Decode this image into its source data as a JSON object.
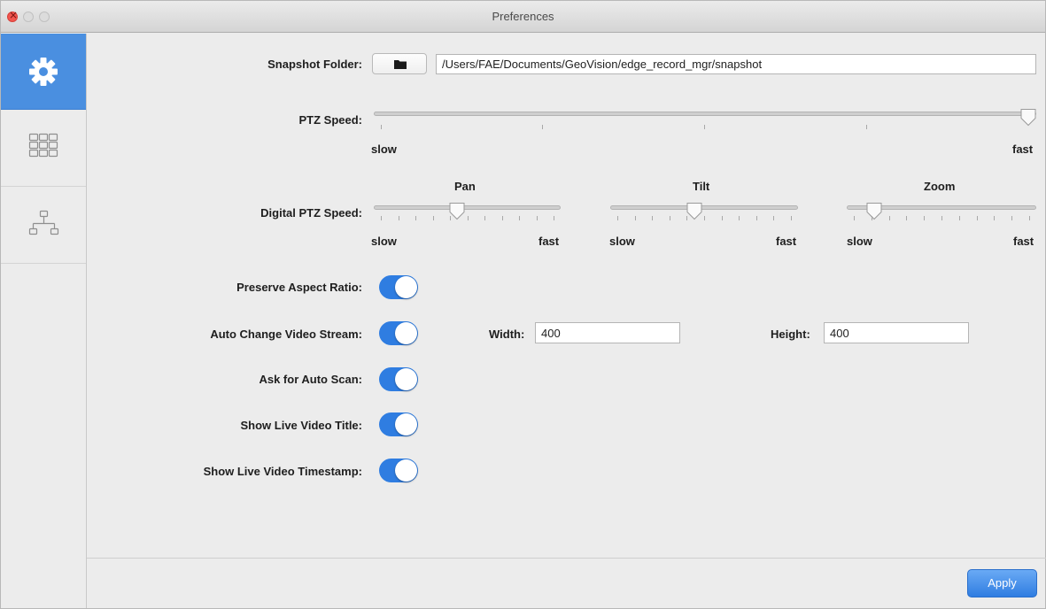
{
  "window": {
    "title": "Preferences"
  },
  "sidebar": {
    "items": [
      {
        "name": "general",
        "icon": "gear-icon",
        "active": true
      },
      {
        "name": "layout",
        "icon": "grid-icon",
        "active": false
      },
      {
        "name": "network",
        "icon": "network-tree-icon",
        "active": false
      }
    ]
  },
  "snapshot": {
    "label": "Snapshot Folder:",
    "button_icon": "folder-icon",
    "path": "/Users/FAE/Documents/GeoVision/edge_record_mgr/snapshot"
  },
  "ptz_speed": {
    "label": "PTZ Speed:",
    "min_label": "slow",
    "max_label": "fast",
    "value": 1.0
  },
  "digital_ptz": {
    "label": "Digital PTZ Speed:",
    "sliders": [
      {
        "title": "Pan",
        "min_label": "slow",
        "max_label": "fast",
        "value": 0.45
      },
      {
        "title": "Tilt",
        "min_label": "slow",
        "max_label": "fast",
        "value": 0.45
      },
      {
        "title": "Zoom",
        "min_label": "slow",
        "max_label": "fast",
        "value": 0.15
      }
    ]
  },
  "toggles": [
    {
      "label": "Preserve Aspect Ratio:",
      "on": true
    },
    {
      "label": "Auto Change Video Stream:",
      "on": true
    },
    {
      "label": "Ask for Auto Scan:",
      "on": true
    },
    {
      "label": "Show Live Video Title:",
      "on": true
    },
    {
      "label": "Show Live Video Timestamp:",
      "on": true
    }
  ],
  "stream_size": {
    "width_label": "Width:",
    "width_value": "400",
    "height_label": "Height:",
    "height_value": "400"
  },
  "footer": {
    "apply_label": "Apply"
  },
  "colors": {
    "accent": "#2f7de1",
    "sidebar_active": "#4a8fe0"
  }
}
